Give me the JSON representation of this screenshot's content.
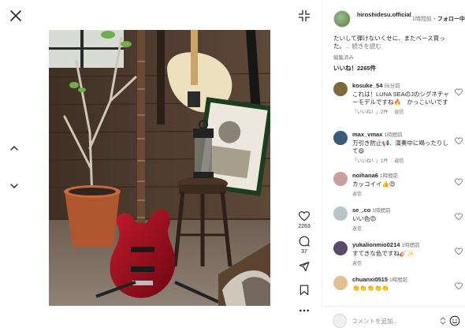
{
  "viewer": {
    "like_count": "2263",
    "comment_count": "37",
    "icons": {
      "close": "close-icon",
      "prev": "chevron-up-icon",
      "next": "chevron-down-icon",
      "collapse": "collapse-icon",
      "like": "heart-icon",
      "comment": "comment-icon",
      "share": "send-icon",
      "save": "bookmark-icon",
      "more": "more-icon"
    }
  },
  "post": {
    "username": "hiroshidesu.official",
    "time": "1時間前",
    "separator": "・",
    "follow_label": "フォロー中",
    "caption": "たいして弾けないくせに、またベース買った。",
    "more_label": "... 続きを読む",
    "edited_label": "編集済み",
    "likes_label": "いいね！2265件"
  },
  "comments": [
    {
      "username": "kosuke_54",
      "time": "56分前",
      "text": "これは！LUNA SEAのJのシグネチャーモデルですね🔥　かっこいいです",
      "likes": "「いいね！」2件",
      "reply": "返信",
      "avatar_color": "#7d6a3a"
    },
    {
      "username": "max_vmax",
      "time": "1時間前",
      "text": "万引き防止📢、演奏中に喝ったりして😄",
      "likes": "「いいね！」1件",
      "reply": "返信",
      "avatar_color": "#3a5a7a"
    },
    {
      "username": "noihana6",
      "time": "1時間前",
      "text": "カッコイイ👍😍",
      "reply": "返信",
      "avatar_color": "#c9a0a0"
    },
    {
      "username": "se_.co",
      "time": "1時間前",
      "text": "いい色😍",
      "reply": "返信",
      "avatar_color": "#b8c4c8"
    },
    {
      "username": "yukalionmio0214",
      "time": "1時間前",
      "text": "すてきな色ですね🎸✨",
      "reply": "返信",
      "avatar_color": "#5a4a6a"
    },
    {
      "username": "chuanxi0515",
      "time": "1時間前",
      "text": "👏👏👏👏👏",
      "reply": "返信",
      "avatar_color": "#e0c090"
    }
  ],
  "composer": {
    "placeholder": "コメントを追加...",
    "emoji_icon": "emoji-icon"
  },
  "colors": {
    "primary_text": "#262626",
    "secondary_text": "#737373",
    "bass_red": "#9a0f1e",
    "divider": "#efefef"
  }
}
